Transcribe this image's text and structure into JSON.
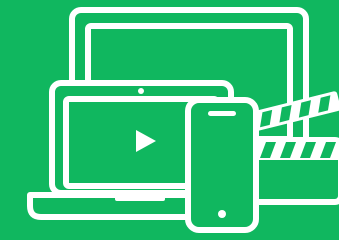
{
  "colors": {
    "background": "#10b75f",
    "stroke": "#ffffff"
  },
  "illustration": {
    "icons": [
      "monitor-icon",
      "laptop-icon",
      "play-icon",
      "smartphone-icon",
      "clapperboard-icon"
    ]
  }
}
